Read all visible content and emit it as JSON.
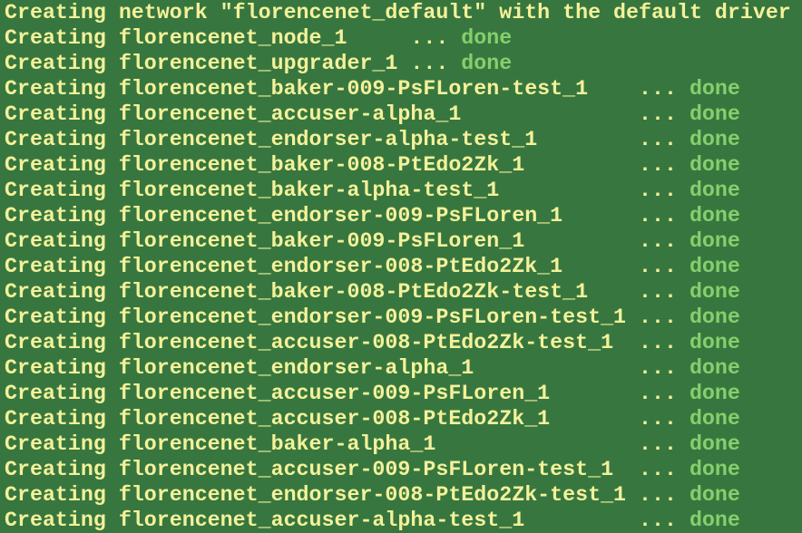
{
  "terminal": {
    "lines": [
      {
        "text": "Creating network \"florencenet_default\" with the default driver",
        "status": ""
      },
      {
        "text": "Creating florencenet_node_1     ... ",
        "status": "done"
      },
      {
        "text": "Creating florencenet_upgrader_1 ... ",
        "status": "done"
      },
      {
        "text": "Creating florencenet_baker-009-PsFLoren-test_1    ... ",
        "status": "done"
      },
      {
        "text": "Creating florencenet_accuser-alpha_1              ... ",
        "status": "done"
      },
      {
        "text": "Creating florencenet_endorser-alpha-test_1        ... ",
        "status": "done"
      },
      {
        "text": "Creating florencenet_baker-008-PtEdo2Zk_1         ... ",
        "status": "done"
      },
      {
        "text": "Creating florencenet_baker-alpha-test_1           ... ",
        "status": "done"
      },
      {
        "text": "Creating florencenet_endorser-009-PsFLoren_1      ... ",
        "status": "done"
      },
      {
        "text": "Creating florencenet_baker-009-PsFLoren_1         ... ",
        "status": "done"
      },
      {
        "text": "Creating florencenet_endorser-008-PtEdo2Zk_1      ... ",
        "status": "done"
      },
      {
        "text": "Creating florencenet_baker-008-PtEdo2Zk-test_1    ... ",
        "status": "done"
      },
      {
        "text": "Creating florencenet_endorser-009-PsFLoren-test_1 ... ",
        "status": "done"
      },
      {
        "text": "Creating florencenet_accuser-008-PtEdo2Zk-test_1  ... ",
        "status": "done"
      },
      {
        "text": "Creating florencenet_endorser-alpha_1             ... ",
        "status": "done"
      },
      {
        "text": "Creating florencenet_accuser-009-PsFLoren_1       ... ",
        "status": "done"
      },
      {
        "text": "Creating florencenet_accuser-008-PtEdo2Zk_1       ... ",
        "status": "done"
      },
      {
        "text": "Creating florencenet_baker-alpha_1                ... ",
        "status": "done"
      },
      {
        "text": "Creating florencenet_accuser-009-PsFLoren-test_1  ... ",
        "status": "done"
      },
      {
        "text": "Creating florencenet_endorser-008-PtEdo2Zk-test_1 ... ",
        "status": "done"
      },
      {
        "text": "Creating florencenet_accuser-alpha-test_1         ... ",
        "status": "done"
      }
    ]
  },
  "colors": {
    "background": "#37773f",
    "text": "#f4f19a",
    "done": "#86cf6c"
  }
}
